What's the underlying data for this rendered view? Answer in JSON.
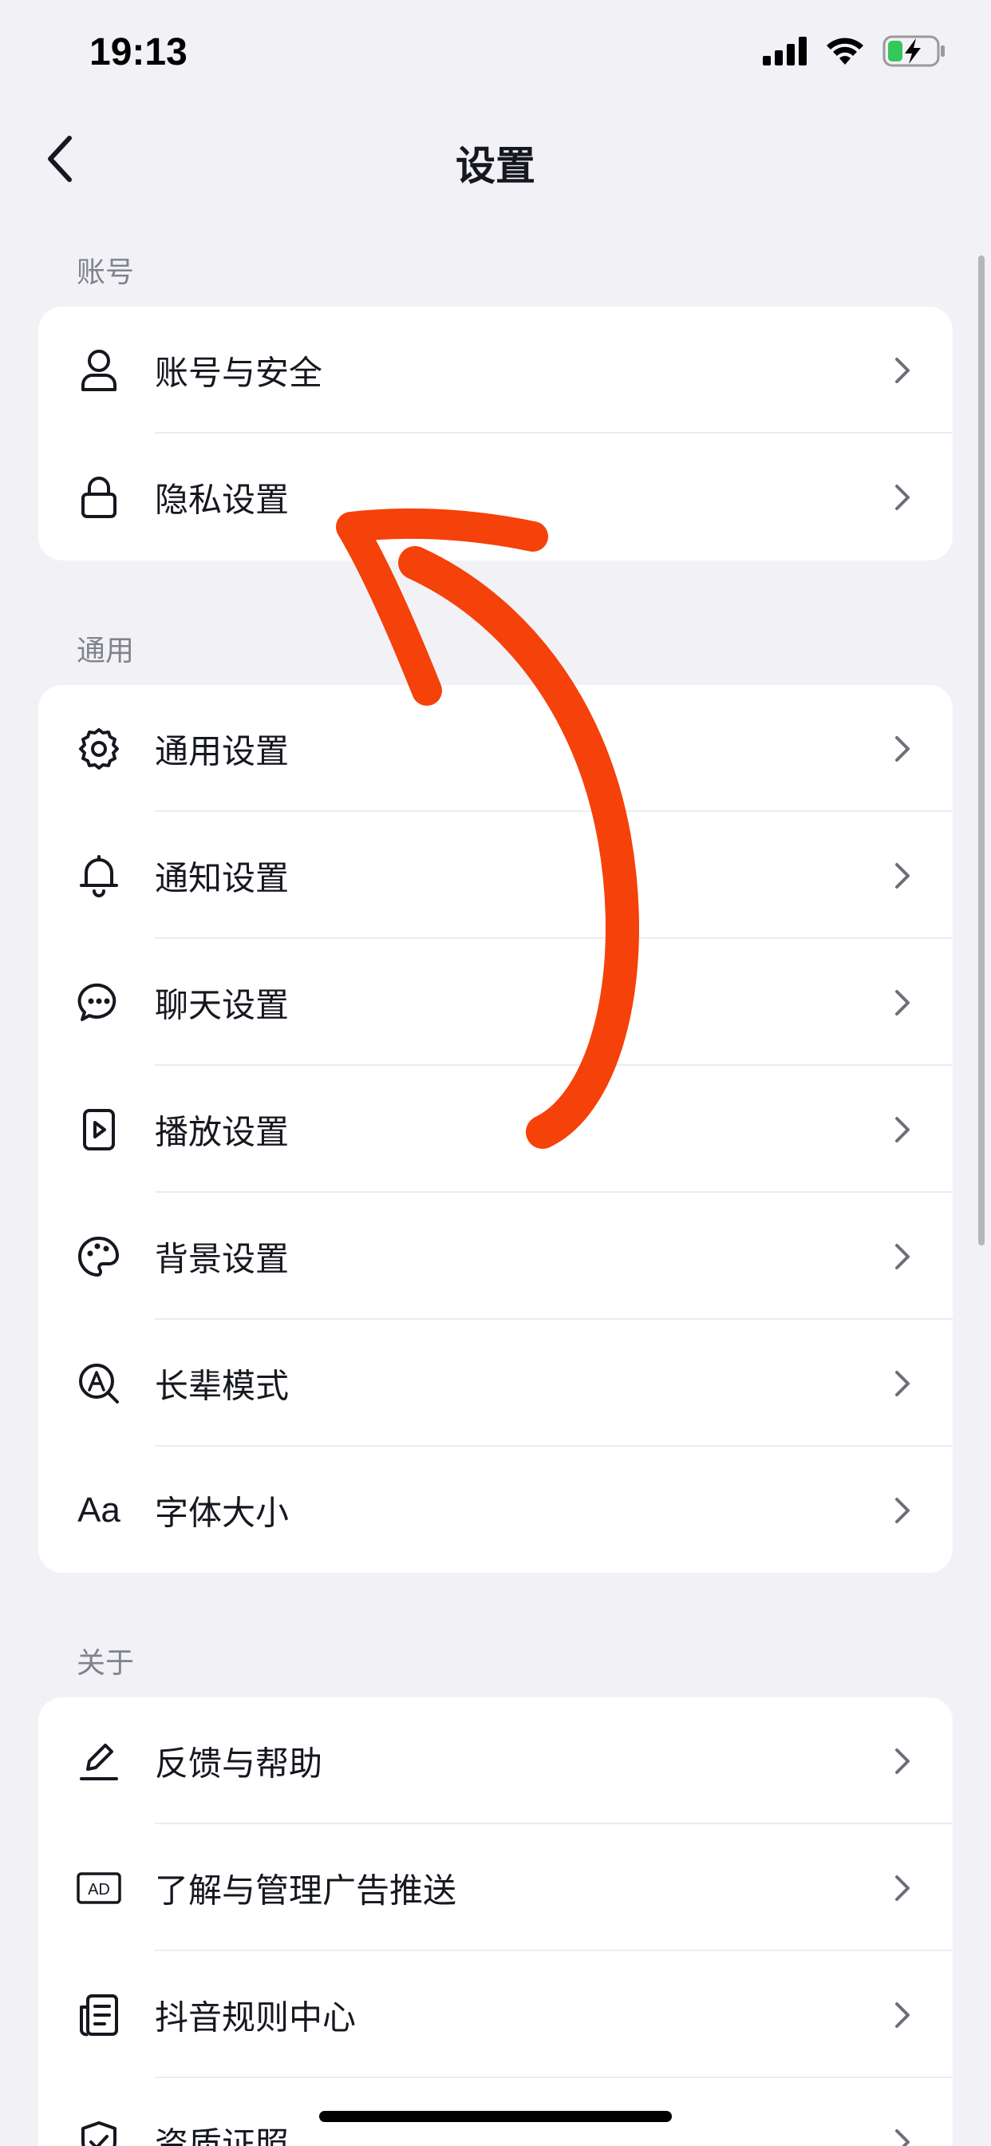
{
  "status_bar": {
    "time": "19:13"
  },
  "nav": {
    "title": "设置"
  },
  "sections": [
    {
      "label": "账号",
      "items": [
        {
          "label": "账号与安全",
          "icon": "user-icon"
        },
        {
          "label": "隐私设置",
          "icon": "lock-icon"
        }
      ]
    },
    {
      "label": "通用",
      "items": [
        {
          "label": "通用设置",
          "icon": "gear-icon"
        },
        {
          "label": "通知设置",
          "icon": "bell-icon"
        },
        {
          "label": "聊天设置",
          "icon": "chat-bubble-icon"
        },
        {
          "label": "播放设置",
          "icon": "play-file-icon"
        },
        {
          "label": "背景设置",
          "icon": "palette-icon"
        },
        {
          "label": "长辈模式",
          "icon": "magnifier-a-icon"
        },
        {
          "label": "字体大小",
          "icon": "font-size-icon",
          "icon_text": "Aa"
        }
      ]
    },
    {
      "label": "关于",
      "items": [
        {
          "label": "反馈与帮助",
          "icon": "pencil-icon"
        },
        {
          "label": "了解与管理广告推送",
          "icon": "ad-icon",
          "icon_text": "AD"
        },
        {
          "label": "抖音规则中心",
          "icon": "rules-document-icon"
        },
        {
          "label": "资质证照",
          "icon": "shield-check-icon"
        }
      ]
    }
  ],
  "colors": {
    "background": "#f2f2f6",
    "card": "#ffffff",
    "text": "#16181f",
    "section_label": "#80838c",
    "annotation_arrow": "#f5410a"
  }
}
